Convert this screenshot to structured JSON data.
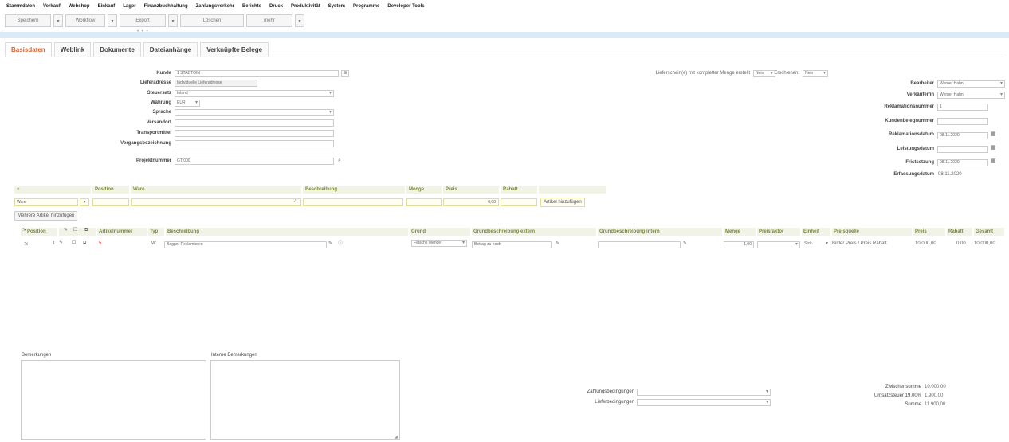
{
  "menubar": [
    "Stammdaten",
    "Verkauf",
    "Webshop",
    "Einkauf",
    "Lager",
    "Finanzbuchhaltung",
    "Zahlungsverkehr",
    "Berichte",
    "Druck",
    "Produktivität",
    "System",
    "Programme",
    "Developer Tools"
  ],
  "toolbar": {
    "save": "Speichern",
    "workflow": "Workflow",
    "export": "Export",
    "delete": "Löschen",
    "more": "mehr"
  },
  "tabs": [
    "Basisdaten",
    "Weblink",
    "Dokumente",
    "Dateianhänge",
    "Verknüpfte Belege"
  ],
  "form_left": {
    "kunde_label": "Kunde",
    "kunde_value": "1 STADTOIN",
    "lieferadresse_label": "Lieferadresse",
    "lieferadresse_value": "Individuelle Lieferadresse",
    "steuersatz_label": "Steuersatz",
    "steuersatz_value": "Inland",
    "waehrung_label": "Währung",
    "waehrung_value": "EUR",
    "sprache_label": "Sprache",
    "sprache_value": "",
    "versandort_label": "Versandort",
    "transportmittel_label": "Transportmittel",
    "vorgangsbezeichnung_label": "Vorgangsbezeichnung",
    "projektnummer_label": "Projektnummer",
    "projektnummer_value": "GT 000"
  },
  "form_right": {
    "liefer_label": "Lieferschein(e) mit kompletter Menge erstellt",
    "liefer_value": "Nein",
    "erschienen_label": "Erschienen:",
    "erschienen_value": "Nein",
    "bearbeiter_label": "Bearbeiter",
    "bearbeiter_value": "Werner Hahn",
    "verkaeufer_label": "Verkäufer/in",
    "verkaeufer_value": "Werner Hahn",
    "reklamationsnummer_label": "Reklamationsnummer",
    "reklamationsnummer_value": "1",
    "kundenbelegnummer_label": "Kundenbelegnummer",
    "kundenbelegnummer_value": "",
    "reklamationsdatum_label": "Reklamationsdatum",
    "reklamationsdatum_value": "08.11.2020",
    "leistungsdatum_label": "Leistungsdatum",
    "leistungsdatum_value": "",
    "fristsetzung_label": "Fristsetzung",
    "fristsetzung_value": "08.11.2020",
    "erfassungsdatum_label": "Erfassungsdatum",
    "erfassungsdatum_value": "08.11.2020"
  },
  "article_entry": {
    "headers": [
      "+",
      "Position",
      "Ware",
      "Beschreibung",
      "Menge",
      "Preis",
      "Rabatt"
    ],
    "type_value": "Ware",
    "price_value": "0,00",
    "add_button": "Artikel hinzufügen",
    "multi_button": "Mehrere Artikel hinzufügen"
  },
  "positions": {
    "headers": [
      "Position",
      "Artikelnummer",
      "Typ",
      "Beschreibung",
      "Grund",
      "Grundbeschreibung extern",
      "Grundbeschreibung intern",
      "Menge",
      "Preisfaktor",
      "Einheit",
      "Preisquelle",
      "Preis",
      "Rabatt",
      "Gesamt"
    ],
    "row": {
      "position": "1",
      "artikelnummer": "5",
      "typ": "W",
      "beschreibung": "Bagger Reklamieren",
      "grund": "Falsche Menge",
      "grund_extern": "Betrag zu hoch",
      "grund_intern": "",
      "menge": "1,00",
      "preisfaktor": "",
      "einheit": "Stck",
      "preisquelle": "Bilder Preis / Preis Rabatt",
      "preis": "10.000,00",
      "rabatt": "0,00",
      "gesamt": "10.000,00"
    }
  },
  "bottom": {
    "bemerkungen_label": "Bemerkungen",
    "interne_label": "Interne Bemerkungen",
    "zahlung_label": "Zahlungsbedingungen",
    "liefer_label": "Lieferbedingungen",
    "zwischensumme_label": "Zwischensumme",
    "zwischensumme_value": "10.000,00",
    "ust_label": "Umsatzsteuer 19,00%",
    "ust_value": "1.900,00",
    "summe_label": "Summe",
    "summe_value": "11.900,00"
  }
}
